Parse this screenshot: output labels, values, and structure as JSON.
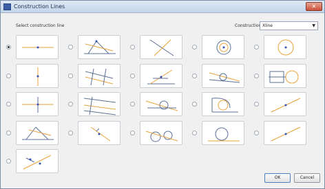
{
  "window": {
    "title": "Construction Lines",
    "close_glyph": "✕"
  },
  "selection": {
    "label": "Select construction line",
    "selected_index": 0
  },
  "mode": {
    "label": "Construction line mode",
    "value": "Xline"
  },
  "buttons": {
    "ok": "OK",
    "cancel": "Cancel"
  },
  "options": [
    {
      "icon": "horizontal-line-icon"
    },
    {
      "icon": "angle-bisector-icon"
    },
    {
      "icon": "cross-lines-icon"
    },
    {
      "icon": "concentric-circles-icon"
    },
    {
      "icon": "circle-center-icon"
    },
    {
      "icon": "vertical-line-icon"
    },
    {
      "icon": "parallel-offset-icon"
    },
    {
      "icon": "angled-line-icon"
    },
    {
      "icon": "line-to-circle-icon"
    },
    {
      "icon": "square-circle-icon"
    },
    {
      "icon": "cross-point-icon"
    },
    {
      "icon": "parallel-lines-icon"
    },
    {
      "icon": "tangent-circle-icon"
    },
    {
      "icon": "tangent-arc-icon"
    },
    {
      "icon": "diagonal-line-icon"
    },
    {
      "icon": "triangle-bisector-icon"
    },
    {
      "icon": "perpendicular-icon"
    },
    {
      "icon": "two-circle-tangent-icon"
    },
    {
      "icon": "circle-tangent-line-icon"
    },
    {
      "icon": "diagonal-line-2-icon"
    },
    {
      "icon": "line-angle-point-icon"
    }
  ],
  "colors": {
    "construction": "#e8a23a",
    "geometry": "#5b6f94",
    "point": "#3050b0"
  }
}
